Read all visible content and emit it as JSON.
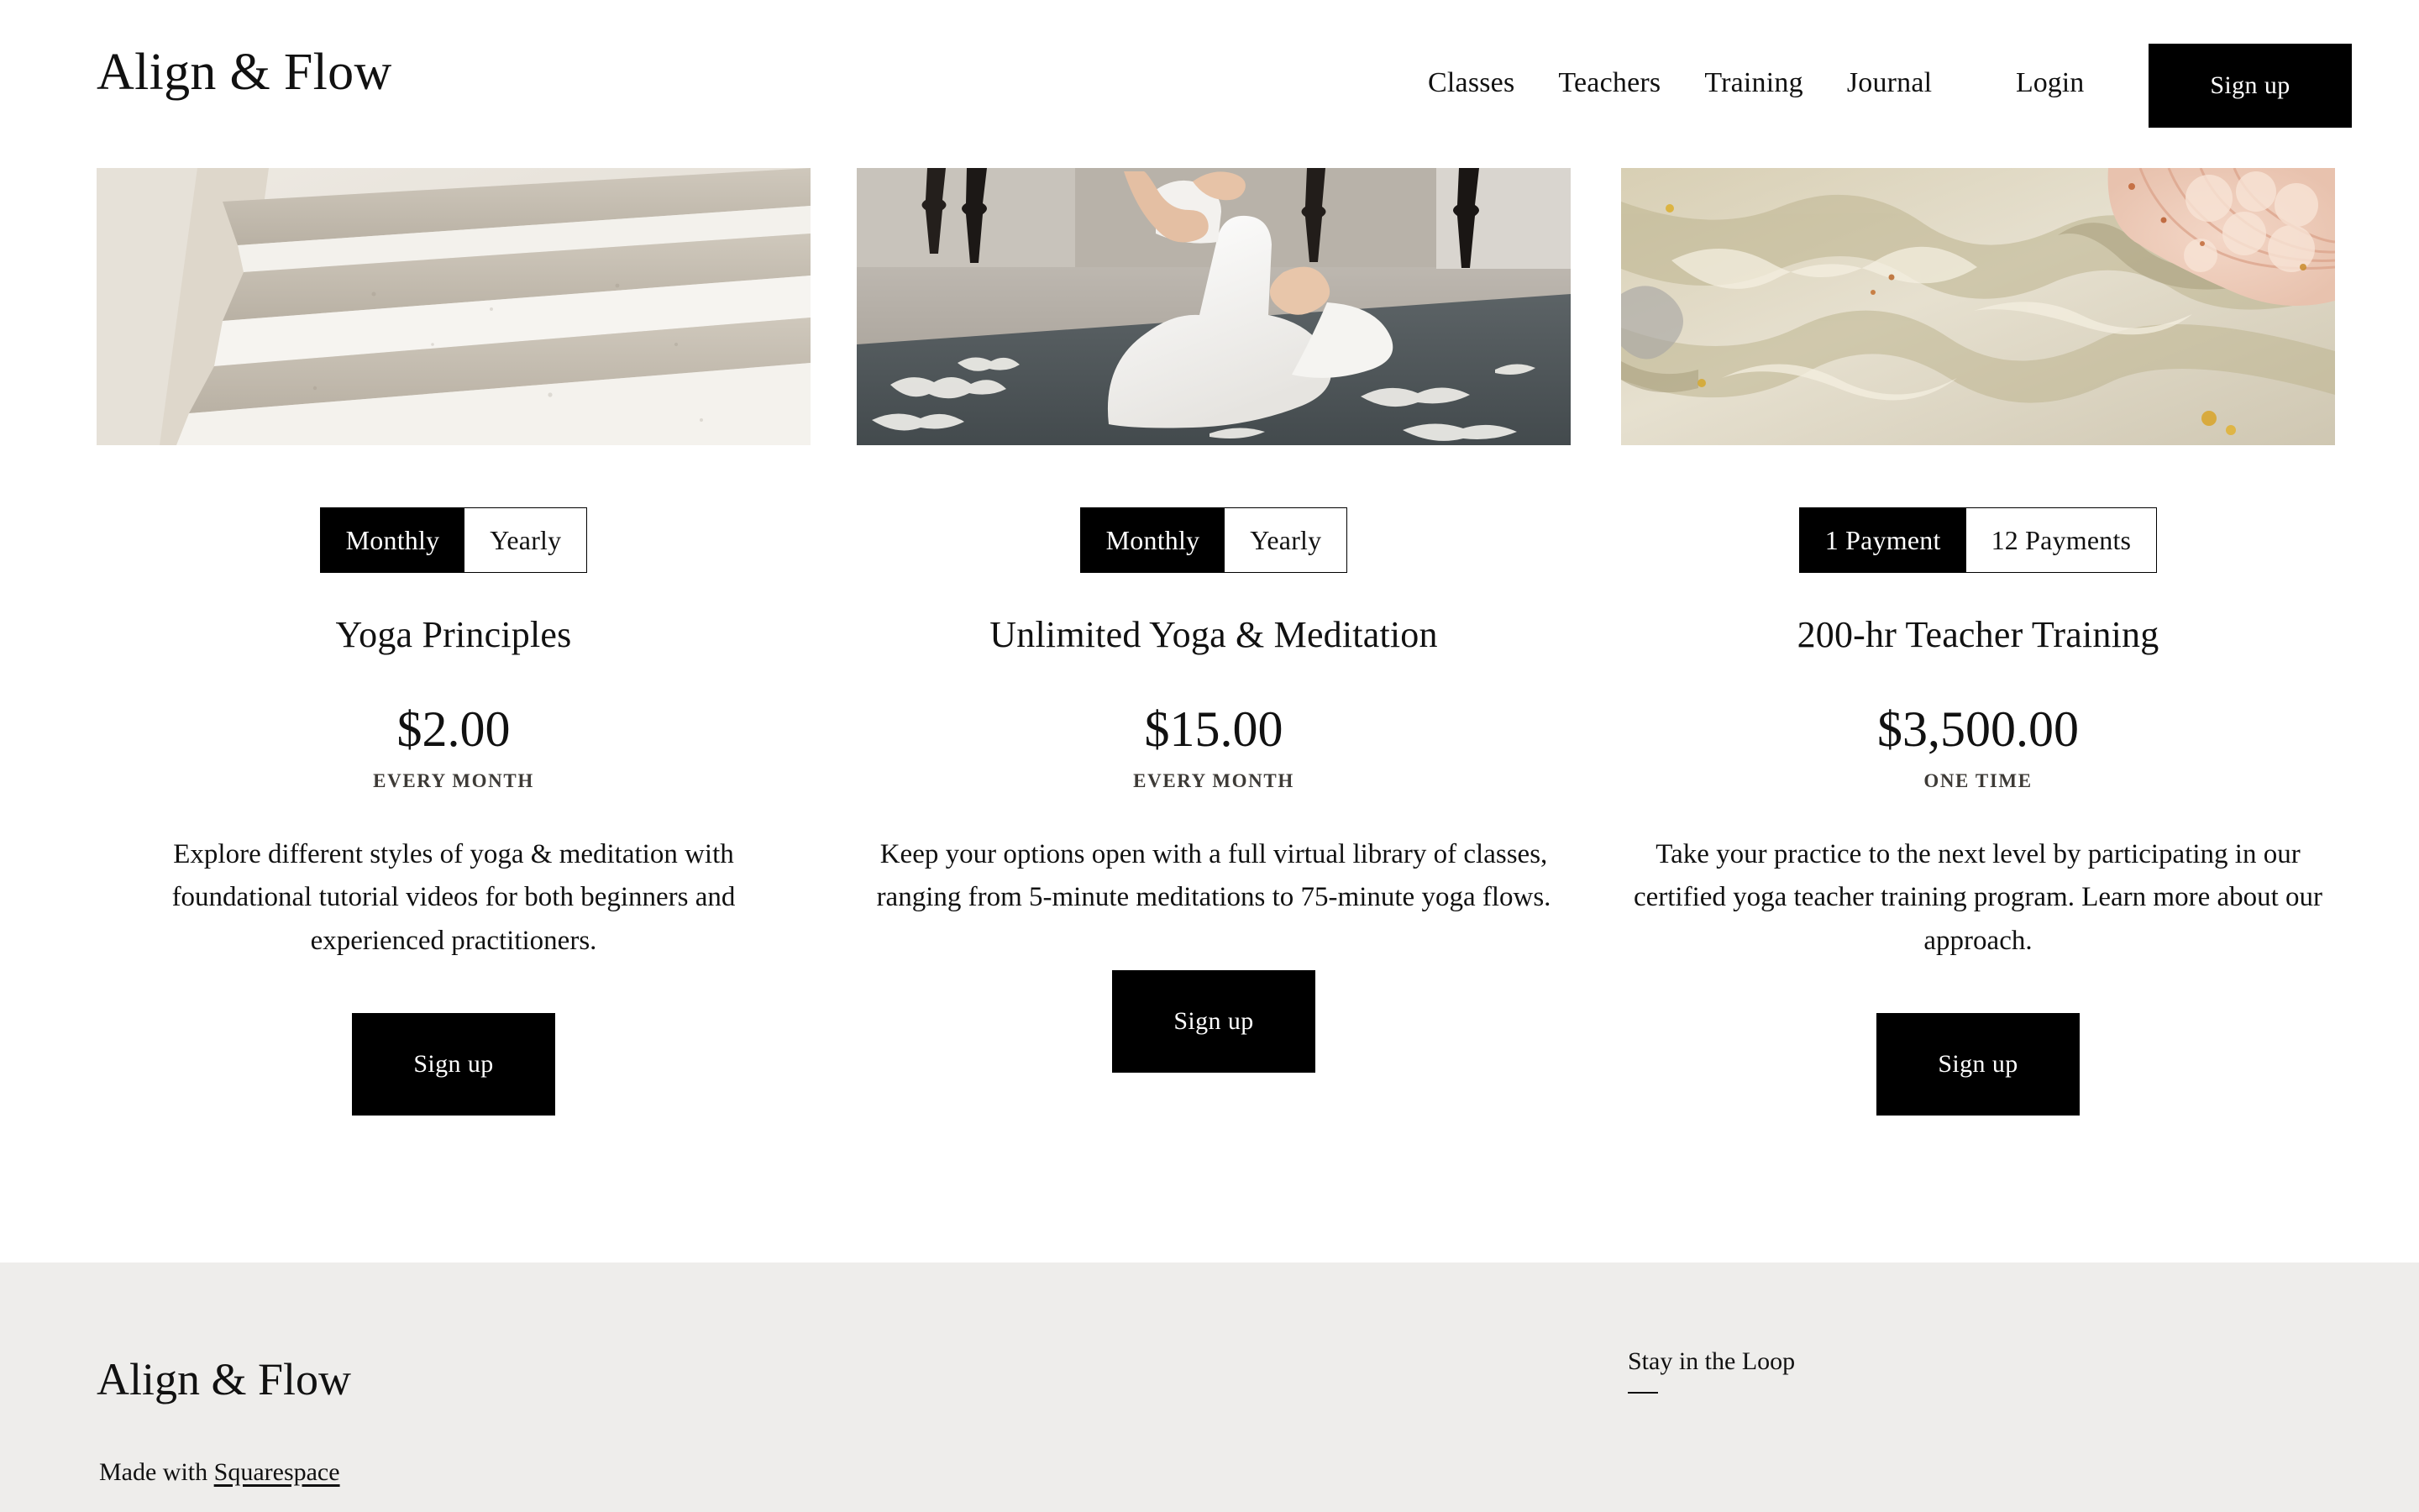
{
  "header": {
    "logo": "Align & Flow",
    "nav_items": [
      {
        "label": "Classes"
      },
      {
        "label": "Teachers"
      },
      {
        "label": "Training"
      },
      {
        "label": "Journal"
      }
    ],
    "login_label": "Login",
    "signup_label": "Sign up"
  },
  "pricing": {
    "cards": [
      {
        "image_name": "stone-stairs-photo",
        "toggle": {
          "option_1": "Monthly",
          "option_2": "Yearly",
          "selected": "Monthly"
        },
        "title": "Yoga Principles",
        "price": "$2.00",
        "period": "EVERY MONTH",
        "description": "Explore different styles of yoga & meditation with foundational tutorial videos for both beginners and experienced practitioners.",
        "cta_label": "Sign up"
      },
      {
        "image_name": "woman-meditating-photo",
        "toggle": {
          "option_1": "Monthly",
          "option_2": "Yearly",
          "selected": "Monthly"
        },
        "title": "Unlimited Yoga & Meditation",
        "price": "$15.00",
        "period": "EVERY MONTH",
        "description": "Keep your options open with a full virtual library of classes, ranging from 5-minute meditations to 75-minute yoga flows.",
        "cta_label": "Sign up"
      },
      {
        "image_name": "onyx-marble-photo",
        "toggle": {
          "option_1": "1 Payment",
          "option_2": "12 Payments",
          "selected": "1 Payment"
        },
        "title": "200-hr Teacher Training",
        "price": "$3,500.00",
        "period": "ONE TIME",
        "description": "Take your practice to the next level by participating in our certified yoga teacher training program. Learn more about our approach.",
        "cta_label": "Sign up"
      }
    ]
  },
  "footer": {
    "brand": "Align & Flow",
    "made_with_prefix": "Made with ",
    "made_with_link": "Squarespace",
    "newsletter_title": "Stay in the Loop"
  },
  "colors": {
    "accent": "#000000",
    "page_bg": "#ffffff",
    "footer_bg": "#eeedeb",
    "text": "#111111",
    "muted_text": "#3d3a36"
  }
}
